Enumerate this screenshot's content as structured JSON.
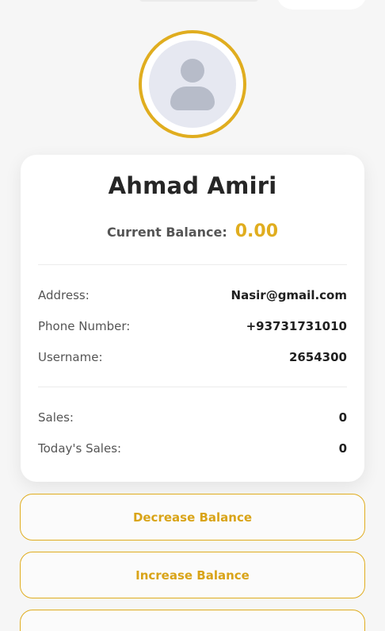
{
  "profile": {
    "name": "Ahmad Amiri",
    "balance_label": "Current Balance:",
    "balance_value": "0.00"
  },
  "details": [
    {
      "label": "Address:",
      "value": "Nasir@gmail.com"
    },
    {
      "label": "Phone Number:",
      "value": "+93731731010"
    },
    {
      "label": "Username:",
      "value": "2654300"
    }
  ],
  "stats": [
    {
      "label": "Sales:",
      "value": "0"
    },
    {
      "label": "Today's Sales:",
      "value": "0"
    }
  ],
  "actions": {
    "decrease_label": "Decrease Balance",
    "increase_label": "Increase Balance"
  },
  "colors": {
    "accent": "#e0ad1f",
    "background": "#f6f6f6",
    "card": "#ffffff"
  },
  "icons": {
    "avatar": "user-placeholder-icon"
  }
}
